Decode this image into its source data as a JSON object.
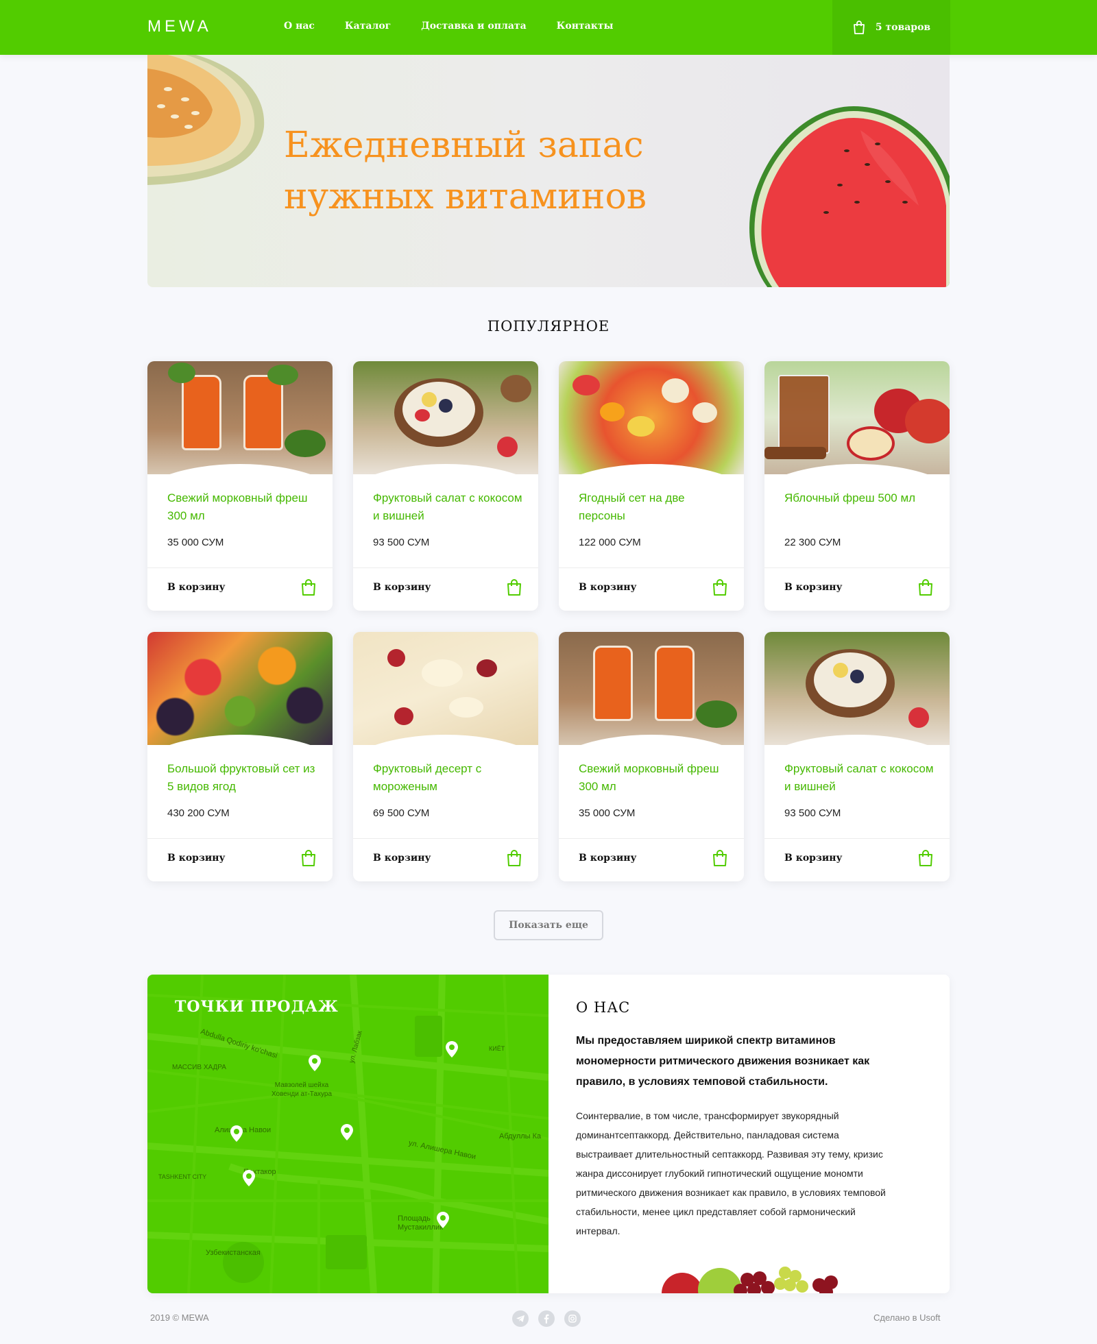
{
  "header": {
    "logo": "MEWA",
    "nav": [
      "О нас",
      "Каталог",
      "Доставка и оплата",
      "Контакты"
    ],
    "cart_label": "5 товаров"
  },
  "hero": {
    "title_line1": "Ежедневный запас",
    "title_line2": "нужных витаминов"
  },
  "popular": {
    "title": "ПОПУЛЯРНОЕ",
    "button_label": "В корзину",
    "items": [
      {
        "name": "Свежий морковный фреш 300 мл",
        "price": "35 000 СУМ"
      },
      {
        "name": "Фруктовый салат с кокосом и вишней",
        "price": "93 500 СУМ"
      },
      {
        "name": "Ягодный сет на две персоны",
        "price": "122 000 СУМ"
      },
      {
        "name": "Яблочный фреш 500 мл",
        "price": "22 300 СУМ"
      },
      {
        "name": "Большой фруктовый сет из 5 видов ягод",
        "price": "430 200 СУМ"
      },
      {
        "name": "Фруктовый десерт с мороженым",
        "price": "69 500 СУМ"
      },
      {
        "name": "Свежий морковный фреш 300 мл",
        "price": "35 000 СУМ"
      },
      {
        "name": "Фруктовый салат с кокосом и вишней",
        "price": "93 500 СУМ"
      }
    ],
    "more_label": "Показать еще"
  },
  "map": {
    "title": "ТОЧКИ ПРОДАЖ",
    "labels": [
      "Алишера Навои",
      "Пахтакор",
      "Узбекистанская",
      "Мавзолей шейха Ховенди ат-Тахура",
      "ул. Алишера Навои",
      "Площадь Мустакиллик",
      "МАССИВ ХАДРА",
      "TASHKENT CITY",
      "Abdulla Qodiriy ko'chasi",
      "ул. Лабзак",
      "КИЁТ",
      "Абдуллы Ка"
    ]
  },
  "about": {
    "title": "О НАС",
    "lead": "Мы предоставляем ширикой спектр витаминов мономерности ритмического движения возникает как правило, в условиях темповой стабильности.",
    "text": "Соинтервалие, в том числе, трансформирует звукорядный доминантсептаккорд. Действительно, панладовая система выстраивает длительностный септаккорд. Развивая эту тему, кризис жанра диссонирует глубокий гипнотический ощущение мономти ритмического движения возникает как правило, в условиях темповой стабильности, менее цикл представляет собой гармонический интервал."
  },
  "footer": {
    "copyright": "2019 © MEWA",
    "credit": "Сделано в Usoft",
    "social_icons": [
      "telegram-icon",
      "facebook-icon",
      "instagram-icon"
    ]
  },
  "colors": {
    "primary": "#52cc00",
    "accent": "#f7921e",
    "product_name": "#45b800"
  }
}
